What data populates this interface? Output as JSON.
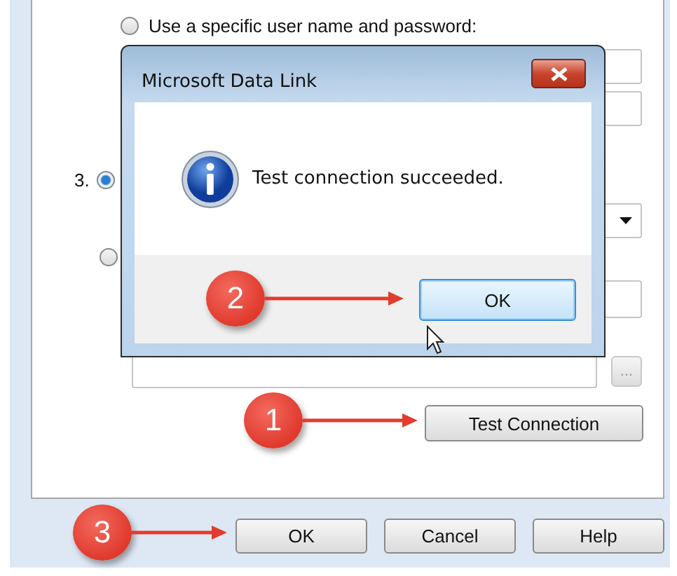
{
  "form": {
    "radios": [
      {
        "label": "Use a specific user name and password:",
        "selected": false
      },
      {
        "selected": true
      },
      {
        "selected": false
      }
    ],
    "step_label": "3.",
    "browse_button": "...",
    "test_button": "Test Connection"
  },
  "dialog": {
    "title": "Microsoft Data Link",
    "message": "Test connection succeeded.",
    "ok_button": "OK"
  },
  "buttons": [
    "OK",
    "Cancel",
    "Help"
  ],
  "callouts": [
    {
      "number": "1"
    },
    {
      "number": "2"
    },
    {
      "number": "3"
    }
  ]
}
